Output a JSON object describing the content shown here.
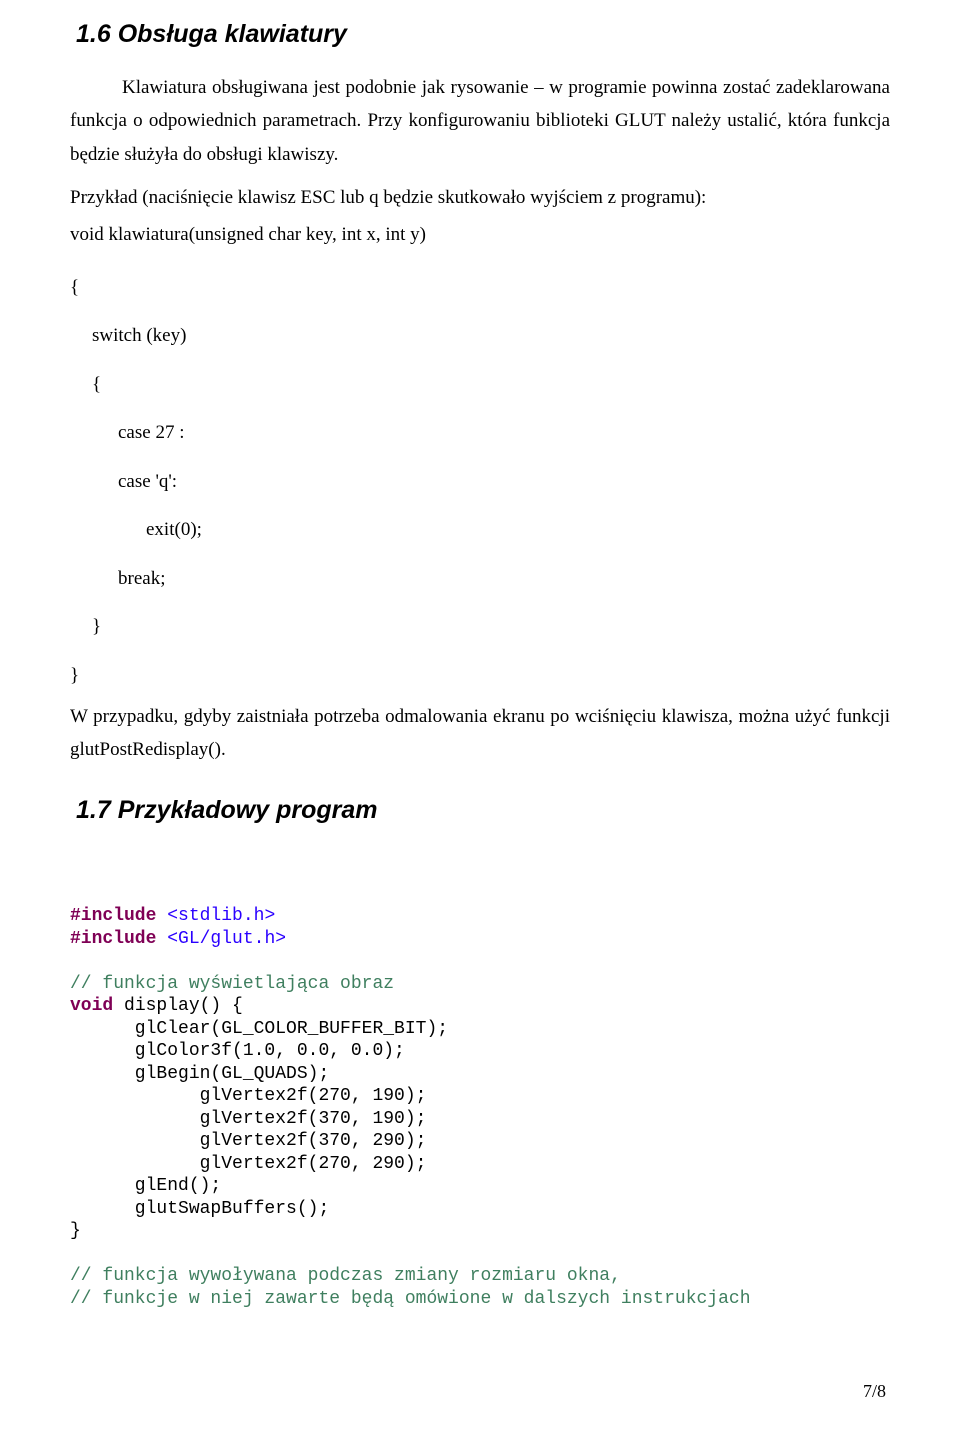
{
  "section1": {
    "heading": "1.6 Obsługa klawiatury",
    "para1": "Klawiatura obsługiwana jest podobnie jak rysowanie – w programie powinna zostać zadeklarowana funkcja o odpowiednich parametrach. Przy konfigurowaniu biblioteki GLUT należy ustalić, która funkcja będzie służyła do obsługi klawiszy.",
    "para2": "Przykład (naciśnięcie klawisz ESC lub q będzie skutkowało wyjściem z programu):",
    "code_sig": "void klawiatura(unsigned char key, int x, int y)",
    "code_lines": {
      "l0": "{",
      "l1": "switch (key)",
      "l2": "{",
      "l3": "case 27 :",
      "l4": "case 'q':",
      "l5": "exit(0);",
      "l6": "break;",
      "l7": "}",
      "l8": "}"
    },
    "para3": "W przypadku, gdyby zaistniała potrzeba odmalowania ekranu po wciśnięciu klawisza, można użyć funkcji glutPostRedisplay()."
  },
  "section2": {
    "heading": "1.7 Przykładowy program",
    "code": {
      "inc1_kw": "#include",
      "inc1_hdr": " <stdlib.h>",
      "inc2_kw": "#include",
      "inc2_hdr": " <GL/glut.h>",
      "cmt1": "// funkcja wyświetlająca obraz",
      "void_kw": "void",
      "disp_rest": " display() {",
      "l1": "      glClear(GL_COLOR_BUFFER_BIT);",
      "l2": "      glColor3f(1.0, 0.0, 0.0);",
      "l3": "      glBegin(GL_QUADS);",
      "l4": "            glVertex2f(270, 190);",
      "l5": "            glVertex2f(370, 190);",
      "l6": "            glVertex2f(370, 290);",
      "l7": "            glVertex2f(270, 290);",
      "l8": "      glEnd();",
      "l9": "      glutSwapBuffers();",
      "l10": "}",
      "cmt2": "// funkcja wywoływana podczas zmiany rozmiaru okna,",
      "cmt3": "// funkcje w niej zawarte będą omówione w dalszych instrukcjach"
    }
  },
  "page_num": "7/8"
}
